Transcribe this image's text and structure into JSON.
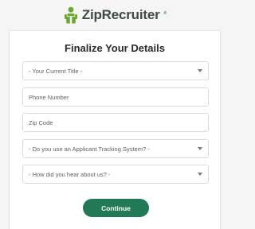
{
  "brand": {
    "name": "ZipRecruiter",
    "trademark": "®",
    "icon": "ziprecruiter-logo-icon",
    "accent_color": "#69a832",
    "button_color": "#217a55"
  },
  "form": {
    "title": "Finalize Your Details",
    "fields": [
      {
        "type": "select",
        "placeholder": "- Your Current Title -"
      },
      {
        "type": "text",
        "placeholder": "Phone Number"
      },
      {
        "type": "text",
        "placeholder": "Zip Code"
      },
      {
        "type": "select",
        "placeholder": "- Do you use an Applicant Tracking System? -"
      },
      {
        "type": "select",
        "placeholder": "- How did you hear about us? -"
      }
    ],
    "submit_label": "Continue"
  }
}
